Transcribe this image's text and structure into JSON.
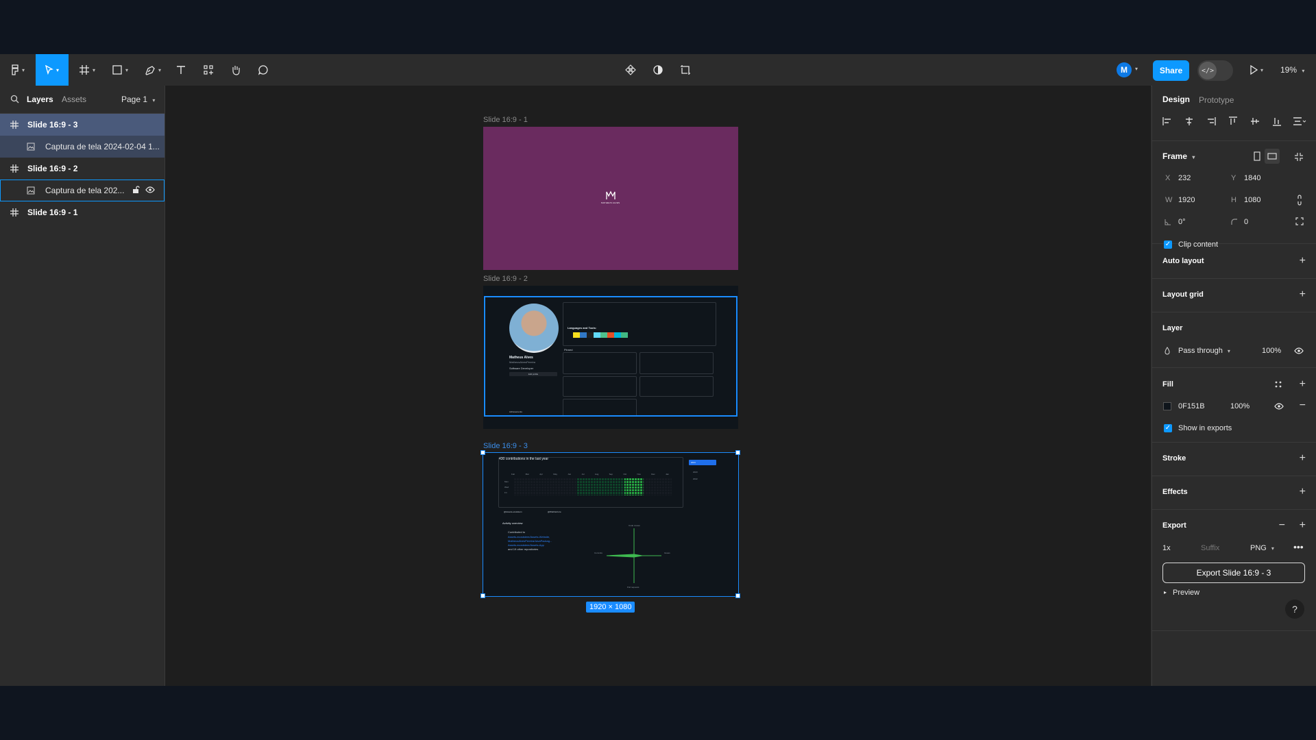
{
  "toolbar": {
    "zoom": "19%",
    "share_label": "Share",
    "user_initial": "M",
    "devmode_glyph": "</>"
  },
  "left_panel": {
    "tabs": [
      "Layers",
      "Assets"
    ],
    "page": "Page 1",
    "layers": [
      {
        "name": "Slide 16:9 - 3",
        "type": "frame"
      },
      {
        "name": "Captura de tela 2024-02-04 1...",
        "type": "image"
      },
      {
        "name": "Slide 16:9 - 2",
        "type": "frame"
      },
      {
        "name": "Captura de tela 202...",
        "type": "image"
      },
      {
        "name": "Slide 16:9 - 1",
        "type": "frame"
      }
    ]
  },
  "canvas": {
    "frames": [
      "Slide 16:9 - 1",
      "Slide 16:9 - 2",
      "Slide 16:9 - 3"
    ],
    "dimension_badge": "1920 × 1080",
    "slide1_logo_text": "MATHEUS ALVES",
    "slide2": {
      "name": "Matheus Alves",
      "handle": "MatheusAlvesPereira",
      "role": "Software Developer",
      "edit_btn": "Edit profile",
      "section": "Languages and Tools:",
      "pinned": "Pinned",
      "achievements": "Achievements"
    },
    "slide3": {
      "contributions": "430 contributions in the last year",
      "months": [
        "Feb",
        "Mar",
        "Apr",
        "May",
        "Jun",
        "Jul",
        "Aug",
        "Sep",
        "Oct",
        "Nov",
        "Dec",
        "Jan"
      ],
      "days": [
        "Mon",
        "Wed",
        "Fri"
      ],
      "year_btn": "2024",
      "years": [
        "2023",
        "2022"
      ],
      "activity": "Activity overview",
      "contributed": "Contributed to",
      "repos": [
        "Assets-ecosistem/Assets-Website,",
        "MatheusAlvesPereira/JavaPackag...",
        "Assets-ecosistem/Assets-App"
      ],
      "more": "and 19 other repositories",
      "orgs": [
        "@Assets-ecosistem",
        "@WebbieCore"
      ],
      "radar": {
        "top": "Code review",
        "right": "Issues",
        "bottom": "Pull requests",
        "left": "Commits"
      }
    }
  },
  "right_panel": {
    "tabs": [
      "Design",
      "Prototype"
    ],
    "frame_label": "Frame",
    "x": "232",
    "y": "1840",
    "w": "1920",
    "h": "1080",
    "rotation": "0°",
    "radius": "0",
    "clip_content": "Clip content",
    "auto_layout": "Auto layout",
    "layout_grid": "Layout grid",
    "layer_title": "Layer",
    "blend": "Pass through",
    "opacity": "100%",
    "fill_title": "Fill",
    "fill_hex": "0F151B",
    "fill_opacity": "100%",
    "fill_color": "#0f151b",
    "show_in_exports": "Show in exports",
    "stroke": "Stroke",
    "effects": "Effects",
    "export_title": "Export",
    "export_scale": "1x",
    "export_suffix": "Suffix",
    "export_format": "PNG",
    "export_button": "Export Slide 16:9 - 3",
    "preview": "Preview",
    "help": "?"
  }
}
